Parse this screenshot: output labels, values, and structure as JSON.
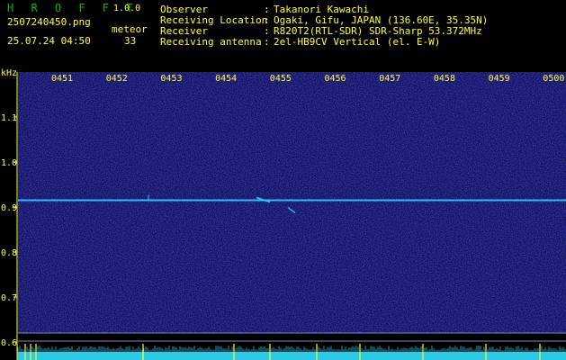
{
  "app": {
    "name": "H R O F F T",
    "version": "1.0.0"
  },
  "file": {
    "name": "2507240450.png",
    "datetime": "25.07.24 04:50"
  },
  "meteor": {
    "label": "meteor",
    "count": "33"
  },
  "info": {
    "rows": [
      {
        "key": "Observer          ",
        "sep": ":",
        "value": "Takanori Kawachi"
      },
      {
        "key": "Receiving Location",
        "sep": ":",
        "value": "Ogaki, Gifu, JAPAN (136.60E, 35.35N)"
      },
      {
        "key": "Receiver          ",
        "sep": ":",
        "value": "R820T2(RTL-SDR) SDR-Sharp 53.372MHz"
      },
      {
        "key": "Receiving antenna ",
        "sep": ":",
        "value": "2el-HB9CV Vertical (el. E-W)"
      }
    ]
  },
  "axis": {
    "unit": "kHz",
    "time_ticks": [
      "0451",
      "0452",
      "0453",
      "0454",
      "0455",
      "0456",
      "0457",
      "0458",
      "0459",
      "0500"
    ],
    "freq_ticks": [
      {
        "label": "1.1",
        "value": 1.1
      },
      {
        "label": "1.0",
        "value": 1.0
      },
      {
        "label": "0.9",
        "value": 0.9
      },
      {
        "label": "0.8",
        "value": 0.8
      },
      {
        "label": "0.7",
        "value": 0.7
      },
      {
        "label": "0.6",
        "value": 0.6
      }
    ]
  },
  "colors": {
    "background": "#000000",
    "spectrogram_noise": "#10107a",
    "carrier": "#2ad0ff",
    "label_text": "#ffff33",
    "brand_green": "#00c000",
    "power_trace": "#30e0ff",
    "power_spikes": "#ffff33"
  }
}
